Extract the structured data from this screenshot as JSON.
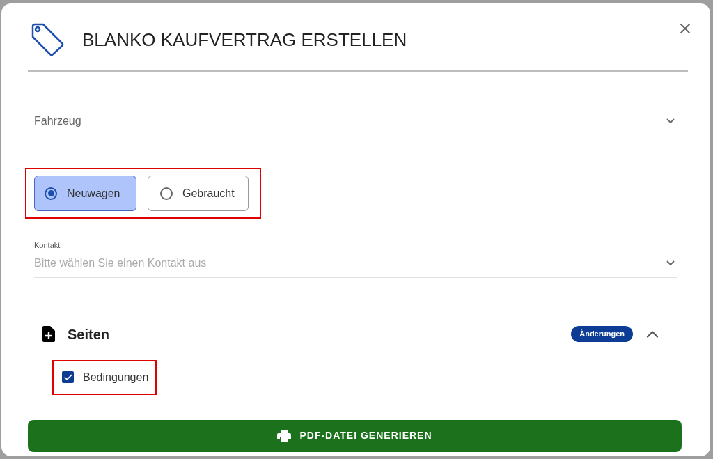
{
  "dialog": {
    "title": "BLANKO KAUFVERTRAG ERSTELLEN"
  },
  "vehicle_select": {
    "placeholder": "Fahrzeug"
  },
  "condition_options": [
    {
      "label": "Neuwagen",
      "selected": true
    },
    {
      "label": "Gebraucht",
      "selected": false
    }
  ],
  "contact_select": {
    "label": "Kontakt",
    "placeholder": "Bitte wählen Sie einen Kontakt aus"
  },
  "pages_section": {
    "title": "Seiten",
    "badge": "Änderungen",
    "expanded": true,
    "items": [
      {
        "label": "Bedingungen",
        "checked": true
      }
    ]
  },
  "generate_button": {
    "label": "PDF-DATEI GENERIEREN"
  }
}
